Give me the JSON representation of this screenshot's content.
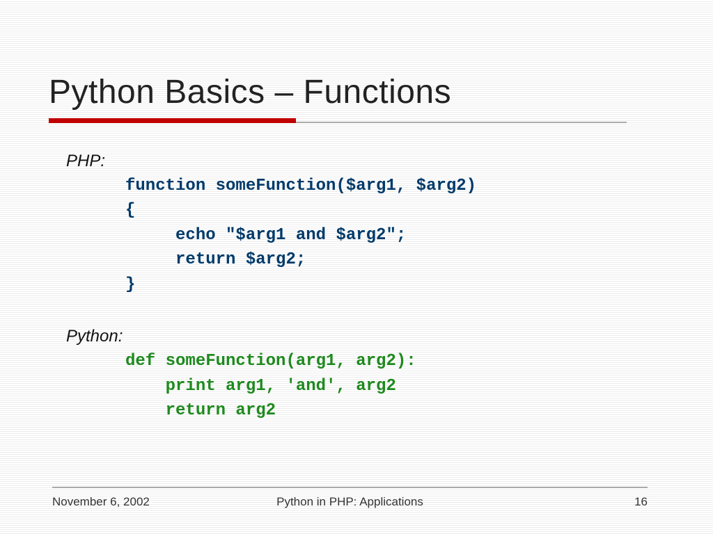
{
  "slide": {
    "title": "Python Basics – Functions",
    "label_php": "PHP:",
    "label_python": "Python:",
    "code_php": "function someFunction($arg1, $arg2)\n{\n     echo \"$arg1 and $arg2\";\n     return $arg2;\n}",
    "code_python": "def someFunction(arg1, arg2):\n    print arg1, 'and', arg2\n    return arg2"
  },
  "footer": {
    "date": "November 6, 2002",
    "subtitle": "Python in PHP: Applications",
    "page": "16"
  }
}
